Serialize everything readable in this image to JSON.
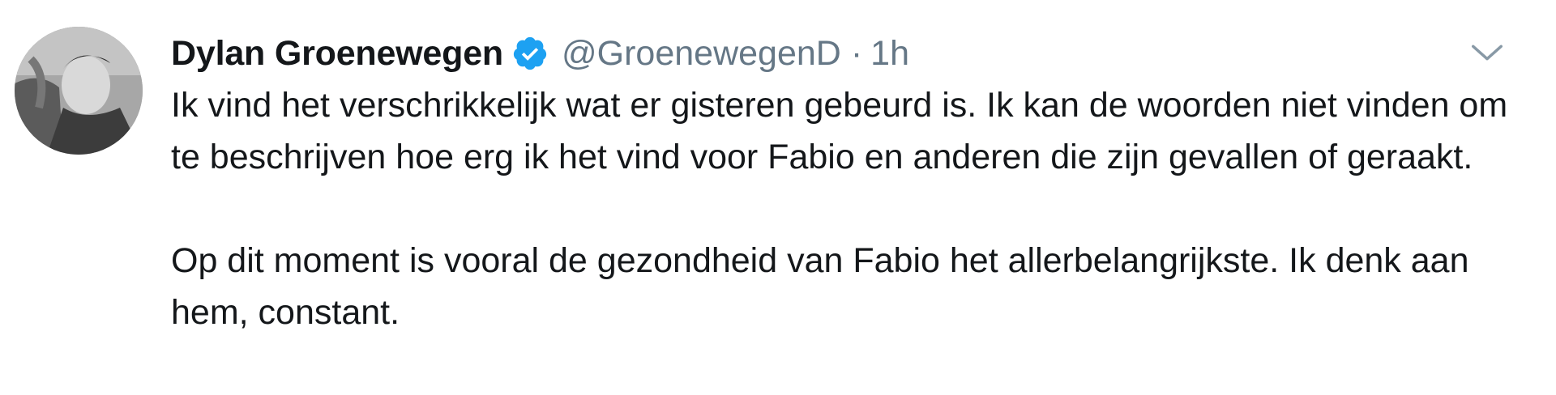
{
  "tweet": {
    "author_name": "Dylan Groenewegen",
    "handle": "@GroenewegenD",
    "separator": "·",
    "time": "1h",
    "verified": true,
    "paragraphs": [
      "Ik vind het verschrikkelijk wat er gisteren gebeurd is. Ik kan de woorden niet vinden om te beschrijven hoe erg ik het vind voor Fabio en anderen die zijn gevallen of geraakt.",
      "Op dit moment is vooral de gezondheid van Fabio het allerbelangrijkste. Ik denk aan hem, constant."
    ]
  },
  "icons": {
    "verified": "verified-badge-icon",
    "caret": "chevron-down-icon"
  },
  "colors": {
    "text": "#14171a",
    "secondary": "#657786",
    "verified_blue": "#1da1f2",
    "background": "#ffffff"
  }
}
